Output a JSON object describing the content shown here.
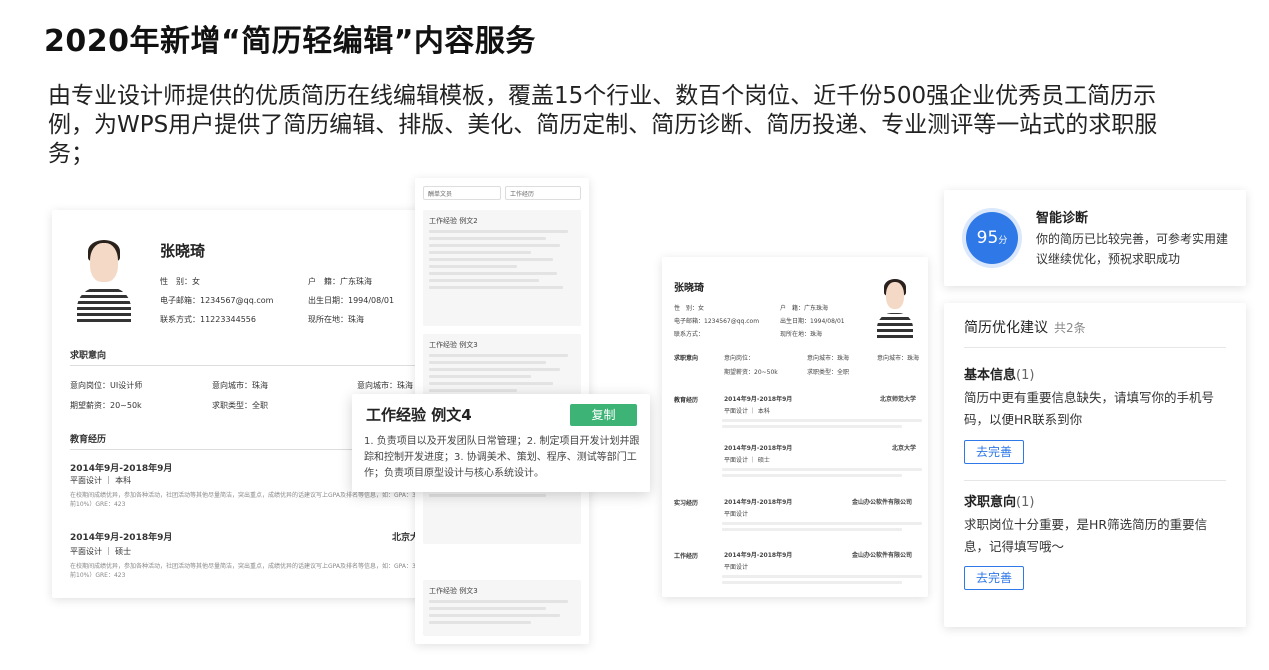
{
  "title": "2020年新增“简历轻编辑”内容服务",
  "description": "由专业设计师提供的优质简历在线编辑模板，覆盖15个行业、数百个岗位、近千份500强企业优秀员工简历示例，为WPS用户提供了简历编辑、排版、美化、简历定制、简历诊断、简历投递、专业测评等一站式的求职服务；",
  "resume1": {
    "name": "张晓琦",
    "gender_label": "性　别：女",
    "hukou_label": "户　籍：广东珠海",
    "email_label": "电子邮箱：1234567@qq.com",
    "birth_label": "出生日期：1994/08/01",
    "phone_label": "联系方式：11223344556",
    "location_label": "现所在地：珠海",
    "intent_section": "求职意向",
    "intent_position": "意向岗位：UI设计师",
    "intent_city": "意向城市：珠海",
    "intent_city2": "意向城市：珠海",
    "salary": "期望薪资：20~50k",
    "job_type": "求职类型：全职",
    "edu_section": "教育经历",
    "edu": [
      {
        "period": "2014年9月-2018年9月",
        "school": "",
        "degree": "平面设计 ｜ 本科",
        "desc": "在校期间成绩优异，参加各种活动，社团活动等其他尽量简洁，突出重点，成绩优异的话建议写上GPA及排名等信息，如：GPA：3.72/4（专业前10%）GRE：423"
      },
      {
        "period": "2014年9月-2018年9月",
        "school": "北京大",
        "degree": "平面设计 ｜ 硕士",
        "desc": "在校期间成绩优异，参加各种活动，社团活动等其他尽量简洁，突出重点，成绩优异的话建议写上GPA及排名等信息，如：GPA：3.72/4（专业前10%）GRE：423"
      }
    ]
  },
  "strip": {
    "select1": "酬单文员",
    "select2": "工作经历",
    "blocks": [
      {
        "title": "工作经验 例文2"
      },
      {
        "title": "工作经验 例文3"
      },
      {
        "title": "工作经验 例文3"
      }
    ]
  },
  "popup": {
    "title": "工作经验 例文4",
    "copy_label": "复制",
    "text": "1. 负责项目以及开发团队日常管理；2. 制定项目开发计划并跟踪和控制开发进度；3. 协调美术、策划、程序、测试等部门工作；负责项目原型设计与核心系统设计。"
  },
  "resume2": {
    "name": "张晓琦",
    "gender": "性　别：女",
    "hukou": "户　籍：广东珠海",
    "email": "电子邮箱：1234567@qq.com",
    "birth": "出生日期：1994/08/01",
    "phone": "联系方式：",
    "location": "现所在地：珠海",
    "intent_label": "求职意向",
    "intent_position": "意向岗位：",
    "intent_city": "意向城市：珠海",
    "intent_city2": "意向城市：珠海",
    "salary": "期望薪资：20~50k",
    "job_type": "求职类型：全职",
    "edu_label": "教育经历",
    "edu1_period": "2014年9月-2018年9月",
    "edu1_school": "北京师范大学",
    "edu1_degree": "平面设计 ｜ 本科",
    "edu2_period": "2014年9月-2018年9月",
    "edu2_school": "北京大学",
    "edu2_degree": "平面设计 ｜ 硕士",
    "intern_label": "实习经历",
    "intern_period": "2014年9月-2018年9月",
    "intern_company": "金山办公软件有限公司",
    "intern_role": "平面设计",
    "work_label": "工作经历",
    "work_period": "2014年9月-2018年9月",
    "work_company": "金山办公软件有限公司",
    "work_role": "平面设计"
  },
  "diagnosis": {
    "score": "95",
    "unit": "分",
    "title": "智能诊断",
    "text": "你的简历已比较完善，可参考实用建议继续优化，预祝求职成功"
  },
  "suggestions": {
    "heading": "简历优化建议",
    "count": "共2条",
    "items": [
      {
        "title": "基本信息",
        "count": "(1)",
        "text": "简历中更有重要信息缺失，请填写你的手机号码，以便HR联系到你",
        "button": "去完善"
      },
      {
        "title": "求职意向",
        "count": "(1)",
        "text": "求职岗位十分重要，是HR筛选简历的重要信息，记得填写哦～",
        "button": "去完善"
      }
    ]
  },
  "colors": {
    "accent_blue": "#2f78e8",
    "copy_green": "#3db476"
  }
}
